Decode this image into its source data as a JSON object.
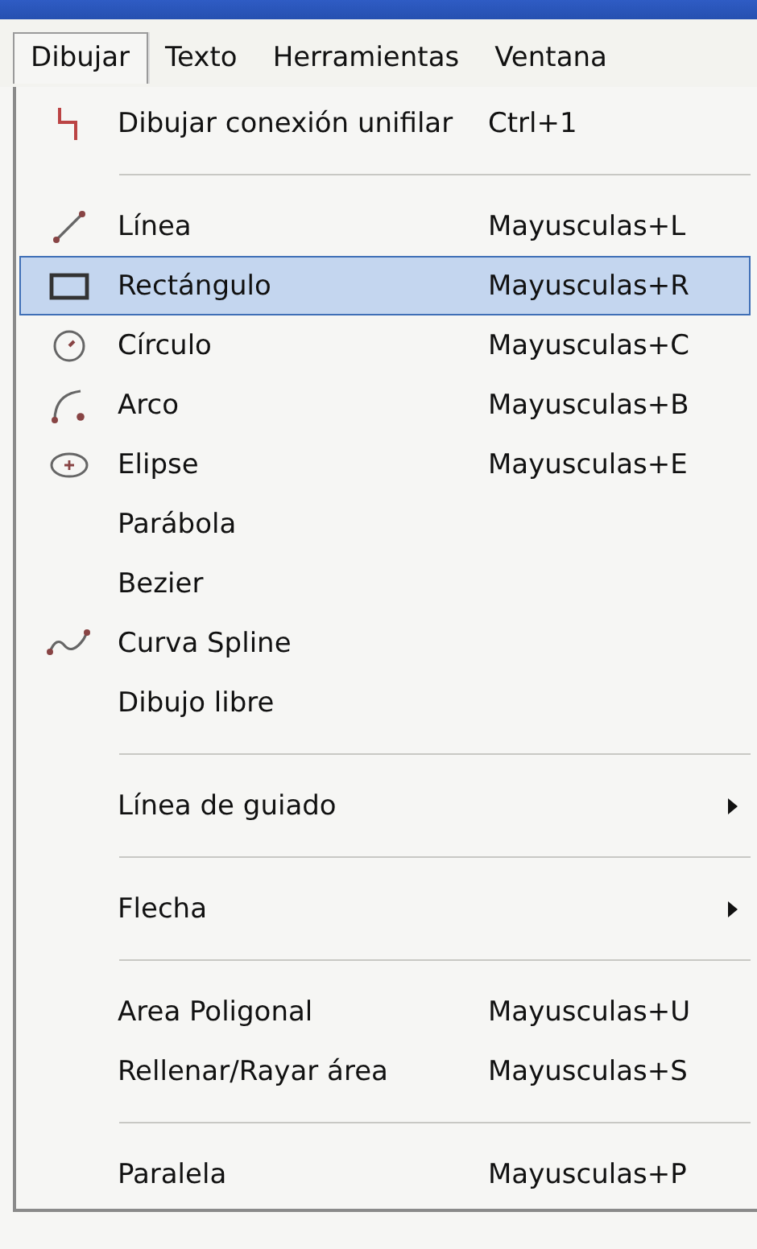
{
  "menubar": [
    {
      "label": "Dibujar",
      "selected": true
    },
    {
      "label": "Texto",
      "selected": false
    },
    {
      "label": "Herramientas",
      "selected": false
    },
    {
      "label": "Ventana",
      "selected": false
    }
  ],
  "menu": [
    {
      "kind": "command",
      "label": "Dibujar conexión unifilar",
      "shortcut": "Ctrl+1",
      "selected": false
    },
    {
      "kind": "separator"
    },
    {
      "kind": "command",
      "label": "Línea",
      "shortcut": "Mayusculas+L",
      "selected": false
    },
    {
      "kind": "command",
      "label": "Rectángulo",
      "shortcut": "Mayusculas+R",
      "selected": true
    },
    {
      "kind": "command",
      "label": "Círculo",
      "shortcut": "Mayusculas+C",
      "selected": false
    },
    {
      "kind": "command",
      "label": "Arco",
      "shortcut": "Mayusculas+B",
      "selected": false
    },
    {
      "kind": "command",
      "label": "Elipse",
      "shortcut": "Mayusculas+E",
      "selected": false
    },
    {
      "kind": "command",
      "label": "Parábola",
      "selected": false
    },
    {
      "kind": "command",
      "label": "Bezier",
      "selected": false
    },
    {
      "kind": "command",
      "label": "Curva Spline",
      "selected": false
    },
    {
      "kind": "command",
      "label": "Dibujo libre",
      "selected": false
    },
    {
      "kind": "separator"
    },
    {
      "kind": "submenu",
      "label": "Línea de guiado",
      "selected": false
    },
    {
      "kind": "separator"
    },
    {
      "kind": "submenu",
      "label": "Flecha",
      "selected": false
    },
    {
      "kind": "separator"
    },
    {
      "kind": "command",
      "label": "Area Poligonal",
      "shortcut": "Mayusculas+U",
      "selected": false
    },
    {
      "kind": "command",
      "label": "Rellenar/Rayar área",
      "shortcut": "Mayusculas+S",
      "selected": false
    },
    {
      "kind": "separator"
    },
    {
      "kind": "command",
      "label": "Paralela",
      "shortcut": "Mayusculas+P",
      "selected": false
    }
  ]
}
